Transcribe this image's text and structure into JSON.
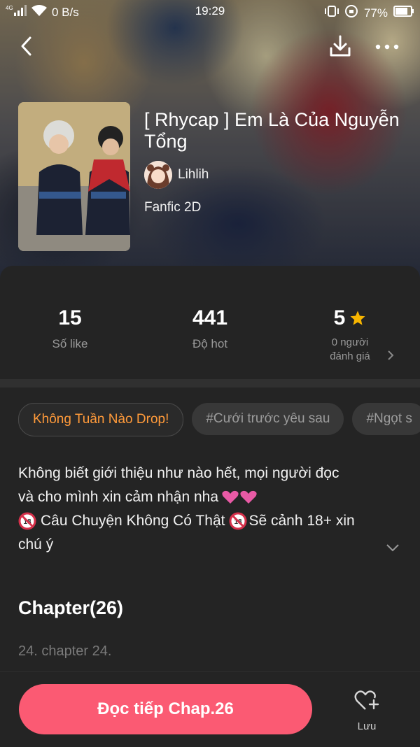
{
  "status_bar": {
    "signal": "4G",
    "speed": "0 B/s",
    "time": "19:29",
    "battery": "77%"
  },
  "story": {
    "title": "[ Rhycap ] Em Là Của Nguyễn Tổng",
    "author": "Lihlih",
    "genre": "Fanfic 2D"
  },
  "stats": {
    "likes": {
      "value": "15",
      "label": "Số like"
    },
    "hot": {
      "value": "441",
      "label": "Độ hot"
    },
    "rating": {
      "value": "5",
      "label_line1": "0 người",
      "label_line2": "đánh giá"
    }
  },
  "tags": [
    "Không Tuần Nào Drop!",
    "#Cưới trước yêu sau",
    "#Ngọt s"
  ],
  "description": {
    "line1": "Không biết giới thiệu như nào hết, mọi người đọc",
    "line2": "và cho mình xin cảm nhận nha",
    "line3a": "Câu Chuyện Không Có Thật",
    "line3b": "Sẽ cảnh 18+ xin",
    "line4": "chú ý"
  },
  "chapters": {
    "heading": "Chapter(26)",
    "latest": "24. chapter 24."
  },
  "actions": {
    "read_label": "Đọc tiếp Chap.26",
    "save_label": "Lưu"
  },
  "colors": {
    "accent": "#fb5a73",
    "tag_highlight": "#ff9a3a",
    "star": "#f7b500"
  }
}
